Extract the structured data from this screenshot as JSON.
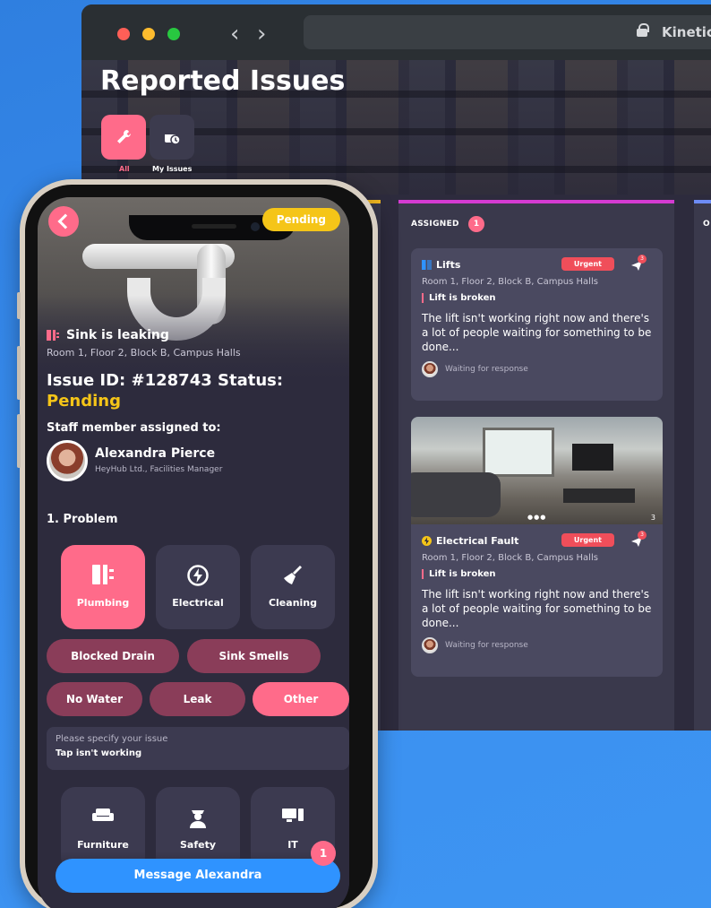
{
  "browser": {
    "url": "Kinetic:",
    "page_title": "Reported Issues",
    "filters": [
      {
        "label": "All",
        "icon": "wrench-icon",
        "active": true
      },
      {
        "label": "My Issues",
        "icon": "calendar-clock-icon",
        "active": false
      }
    ]
  },
  "board": {
    "assigned": {
      "title": "ASSIGNED",
      "count": "1",
      "cards": [
        {
          "category": "Lifts",
          "priority": "Urgent",
          "send_count": "3",
          "location": "Room 1, Floor 2, Block B, Campus Halls",
          "issue": "Lift is broken",
          "description": "The lift isn't working right now and there's a lot of people waiting for something to be done...",
          "status": "Waiting for response"
        },
        {
          "photo_count": "3",
          "category": "Electrical Fault",
          "priority": "Urgent",
          "send_count": "3",
          "location": "Room 1, Floor 2, Block B, Campus Halls",
          "issue": "Lift is broken",
          "description": "The lift isn't working right now and there's a lot of people waiting for something to be done...",
          "status": "Waiting for response"
        }
      ]
    },
    "third_column_letter": "O"
  },
  "phone": {
    "status_pill": "Pending",
    "category": "Sink is leaking",
    "location": "Room 1, Floor 2, Block B, Campus Halls",
    "issue_id_line": "Issue ID: #128743 Status:",
    "status": "Pending",
    "staff_heading": "Staff member assigned to:",
    "staff_name": "Alexandra Pierce",
    "staff_role": "HeyHub Ltd., Facilities Manager",
    "problem_heading": "1. Problem",
    "types": [
      {
        "label": "Plumbing",
        "active": true
      },
      {
        "label": "Electrical",
        "active": false
      },
      {
        "label": "Cleaning",
        "active": false
      }
    ],
    "subtypes": [
      {
        "label": "Blocked Drain",
        "active": false
      },
      {
        "label": "Sink Smells",
        "active": false
      },
      {
        "label": "No Water",
        "active": false
      },
      {
        "label": "Leak",
        "active": false
      },
      {
        "label": "Other",
        "active": true
      }
    ],
    "specify_placeholder": "Please specify your issue",
    "specify_value": "Tap isn't working",
    "more_types": [
      {
        "label": "Furniture"
      },
      {
        "label": "Safety"
      },
      {
        "label": "IT"
      }
    ],
    "message_button": "Message Alexandra",
    "message_badge": "1"
  },
  "colors": {
    "accent": "#ff6b8a",
    "pending": "#f5c518",
    "urgent": "#f04e5a",
    "assigned_bar": "#d43bd2",
    "message": "#2f93ff"
  }
}
